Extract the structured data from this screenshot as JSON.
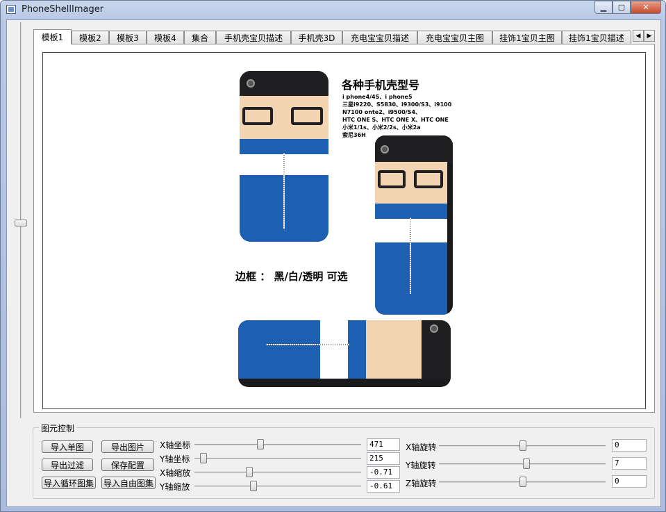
{
  "window": {
    "title": "PhoneShellImager"
  },
  "tabs": [
    "模板1",
    "模板2",
    "模板3",
    "模板4",
    "集合",
    "手机壳宝贝描述",
    "手机壳3D",
    "充电宝宝贝描述",
    "充电宝宝贝主图",
    "挂饰1宝贝主图",
    "挂饰1宝贝描述"
  ],
  "active_tab": 0,
  "product_image": {
    "title": "各种手机壳型号",
    "models": [
      "i phone4/4S、i phone5",
      "三星i9220、S5830、i9300/S3、i9100",
      "N7100 onte2、i9500/S4、",
      "HTC ONE S、HTC ONE X、HTC ONE",
      "小米1/1s、小米2/2s、小米2a",
      "索尼36H"
    ],
    "frame_text": "边框 ： 黑/白/透明 可选"
  },
  "controls": {
    "group_title": "图元控制",
    "buttons": {
      "import_single": "导入单图",
      "export_image": "导出图片",
      "export_filter": "导出过滤",
      "save_config": "保存配置",
      "import_loop": "导入循环图集",
      "import_free": "导入自由图集"
    },
    "sliders": [
      {
        "label": "X轴坐标",
        "value": "471"
      },
      {
        "label": "Y轴坐标",
        "value": "215"
      },
      {
        "label": "X轴缩放",
        "value": "-0.71"
      },
      {
        "label": "Y轴缩放",
        "value": "-0.61"
      }
    ],
    "rotations": [
      {
        "label": "X轴旋转",
        "value": "0"
      },
      {
        "label": "Y轴旋转",
        "value": "7"
      },
      {
        "label": "Z轴旋转",
        "value": "0"
      }
    ]
  }
}
